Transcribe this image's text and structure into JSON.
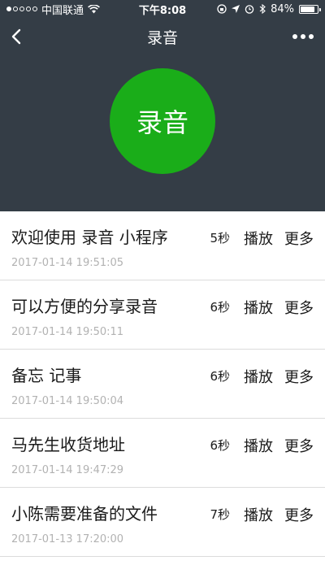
{
  "status_bar": {
    "carrier": "中国联通",
    "time": "下午8:08",
    "battery": "84%",
    "battery_level": 0.84
  },
  "nav": {
    "title": "录音"
  },
  "record_button": {
    "label": "录音",
    "color": "#1aad19"
  },
  "recordings": [
    {
      "title": "欢迎使用 录音 小程序",
      "time": "2017-01-14 19:51:05",
      "duration": "5秒",
      "play": "播放",
      "more": "更多"
    },
    {
      "title": "可以方便的分享录音",
      "time": "2017-01-14 19:50:11",
      "duration": "6秒",
      "play": "播放",
      "more": "更多"
    },
    {
      "title": "备忘 记事",
      "time": "2017-01-14 19:50:04",
      "duration": "6秒",
      "play": "播放",
      "more": "更多"
    },
    {
      "title": "马先生收货地址",
      "time": "2017-01-14 19:47:29",
      "duration": "6秒",
      "play": "播放",
      "more": "更多"
    },
    {
      "title": "小陈需要准备的文件",
      "time": "2017-01-13 17:20:00",
      "duration": "7秒",
      "play": "播放",
      "more": "更多"
    }
  ]
}
